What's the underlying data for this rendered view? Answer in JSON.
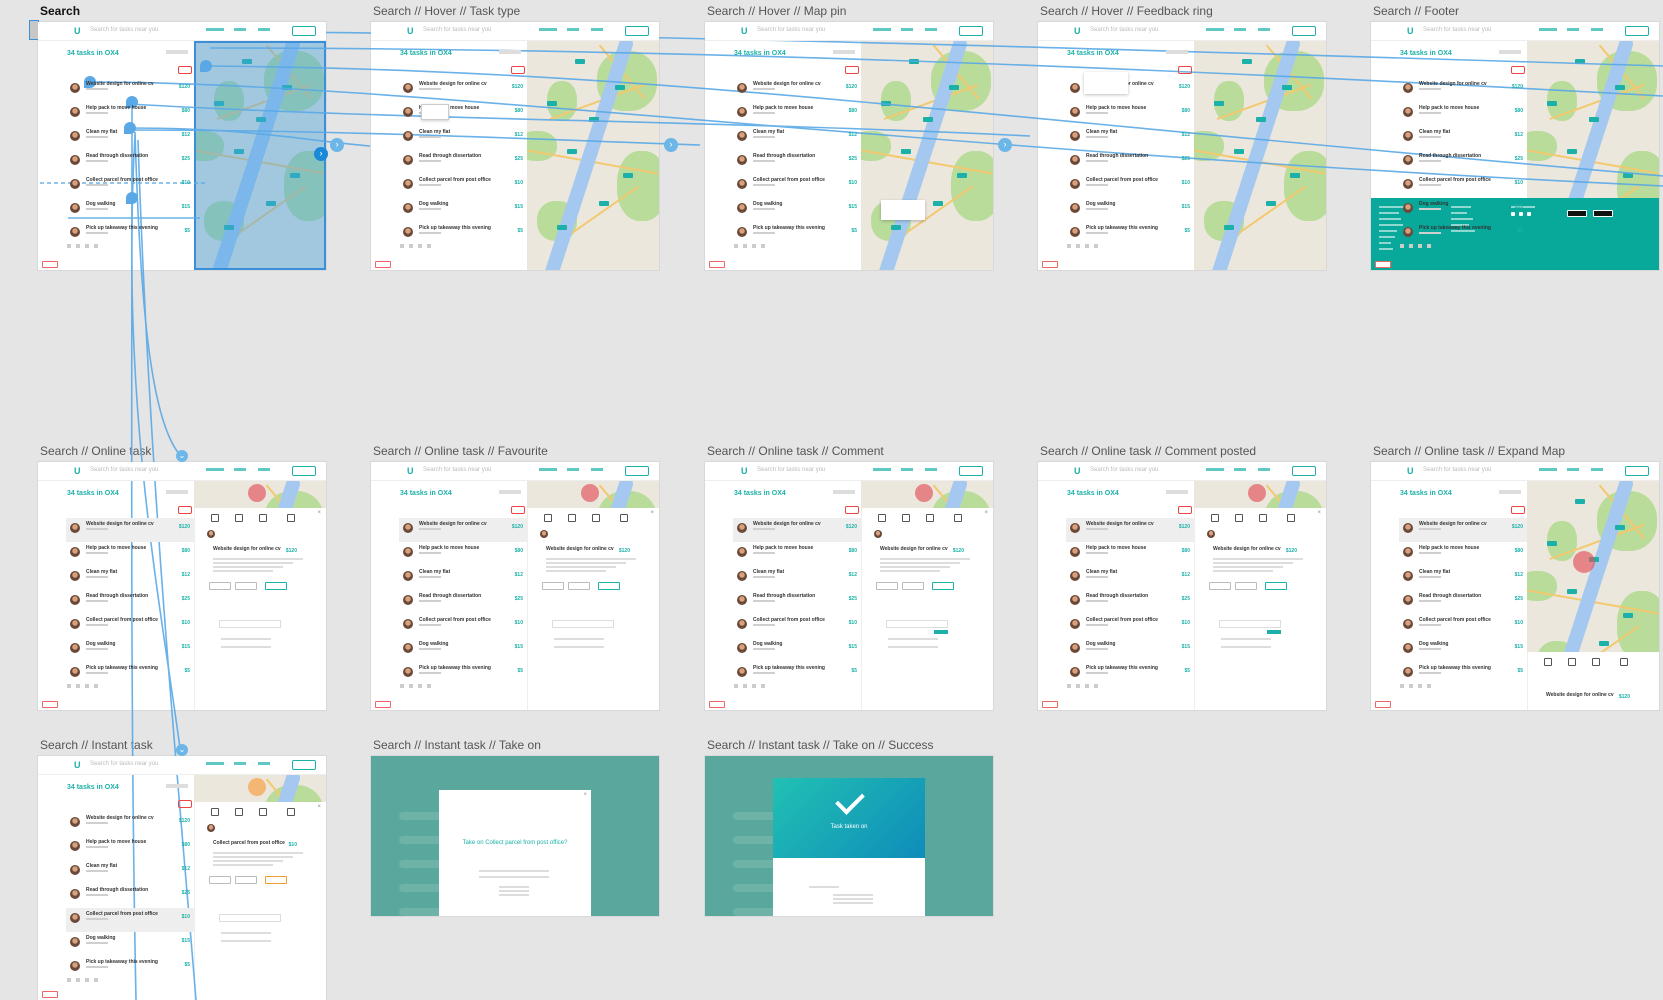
{
  "artboards": [
    {
      "id": "a1",
      "title": "Search",
      "kind": "map",
      "selected": true,
      "flow_target": true
    },
    {
      "id": "a2",
      "title": "Search // Hover // Task type",
      "kind": "map",
      "tooltip": "row"
    },
    {
      "id": "a3",
      "title": "Search // Hover // Map pin",
      "kind": "map",
      "tooltip": "pin"
    },
    {
      "id": "a4",
      "title": "Search // Hover // Feedback ring",
      "kind": "map",
      "tooltip": "ring"
    },
    {
      "id": "a5",
      "title": "Search // Footer",
      "kind": "footer"
    },
    {
      "id": "b1",
      "title": "Search // Online task",
      "kind": "panel"
    },
    {
      "id": "b2",
      "title": "Search // Online task // Favourite",
      "kind": "panel"
    },
    {
      "id": "b3",
      "title": "Search // Online task // Comment",
      "kind": "panel"
    },
    {
      "id": "b4",
      "title": "Search // Online task // Comment posted",
      "kind": "panel"
    },
    {
      "id": "b5",
      "title": "Search // Online task // Expand Map",
      "kind": "expand"
    },
    {
      "id": "c1",
      "title": "Search // Instant task",
      "kind": "panel-instant"
    },
    {
      "id": "c2",
      "title": "Search // Instant task // Take on",
      "kind": "modal"
    },
    {
      "id": "c3",
      "title": "Search // Instant task // Take on // Success",
      "kind": "success"
    }
  ],
  "app": {
    "logo": "U",
    "search_placeholder": "Search for tasks near you",
    "list_heading": "34 tasks in OX4",
    "rows": [
      {
        "title": "Website design for online cv",
        "price": "$120"
      },
      {
        "title": "Help pack to move house",
        "price": "$80"
      },
      {
        "title": "Clean my flat",
        "price": "$12"
      },
      {
        "title": "Read through dissertation",
        "price": "$25"
      },
      {
        "title": "Collect parcel from post office",
        "price": "$10"
      },
      {
        "title": "Dog walking",
        "price": "$15"
      },
      {
        "title": "Pick up takeaway this evening",
        "price": "$5"
      }
    ]
  },
  "modal": {
    "title": "Take on Collect parcel from post office?"
  },
  "success": {
    "title": "Task taken on"
  },
  "colors": {
    "brand": "#1bb1a8",
    "flow": "#5aa9e6",
    "canvas": "#e5e5e5",
    "footer": "#08a99b",
    "modal_overlay": "#5aa89d"
  }
}
